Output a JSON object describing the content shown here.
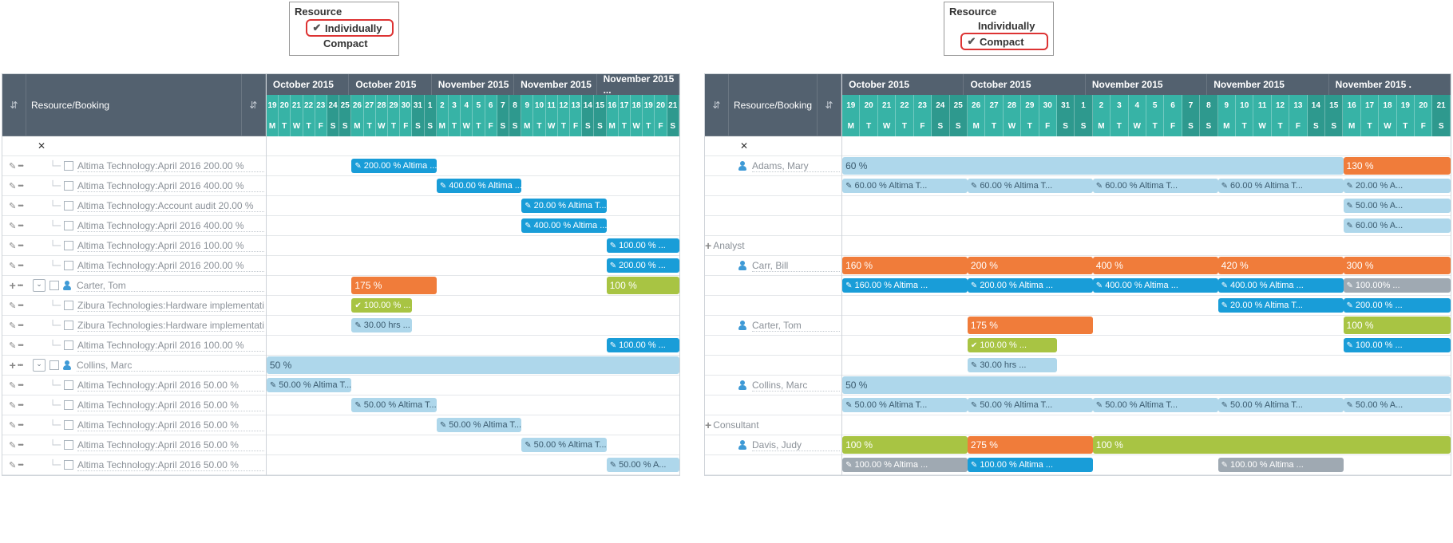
{
  "left": {
    "resource_title": "Resource",
    "options": [
      "Individually",
      "Compact"
    ],
    "selected_index": 0,
    "header_label": "Resource/Booking",
    "months": [
      "October 2015",
      "October 2015",
      "November 2015",
      "November 2015",
      "November 2015 ..."
    ],
    "days_num": [
      "19",
      "20",
      "21",
      "22",
      "23",
      "24",
      "25",
      "26",
      "27",
      "28",
      "29",
      "30",
      "31",
      "1",
      "2",
      "3",
      "4",
      "5",
      "6",
      "7",
      "8",
      "9",
      "10",
      "11",
      "12",
      "13",
      "14",
      "15",
      "16",
      "17",
      "18",
      "19",
      "20",
      "21"
    ],
    "days_dow": [
      "M",
      "T",
      "W",
      "T",
      "F",
      "S",
      "S",
      "M",
      "T",
      "W",
      "T",
      "F",
      "S",
      "S",
      "M",
      "T",
      "W",
      "T",
      "F",
      "S",
      "S",
      "M",
      "T",
      "W",
      "T",
      "F",
      "S",
      "S",
      "M",
      "T",
      "W",
      "T",
      "F",
      "S"
    ],
    "rows": [
      {
        "type": "close"
      },
      {
        "type": "item",
        "label": "Altima Technology:April 2016 200.00 %",
        "bars": [
          {
            "start": 7,
            "span": 7,
            "cls": "c-blue",
            "icon": "pen",
            "text": "200.00 % Altima ..."
          }
        ]
      },
      {
        "type": "item",
        "label": "Altima Technology:April 2016 400.00 %",
        "bars": [
          {
            "start": 14,
            "span": 7,
            "cls": "c-blue",
            "icon": "pen",
            "text": "400.00 % Altima ..."
          }
        ]
      },
      {
        "type": "item",
        "label": "Altima Technology:Account audit 20.00 %",
        "bars": [
          {
            "start": 21,
            "span": 7,
            "cls": "c-blue",
            "icon": "pen",
            "text": "20.00 % Altima T..."
          }
        ]
      },
      {
        "type": "item",
        "label": "Altima Technology:April 2016 400.00 %",
        "bars": [
          {
            "start": 21,
            "span": 7,
            "cls": "c-blue",
            "icon": "pen",
            "text": "400.00 % Altima ..."
          }
        ]
      },
      {
        "type": "item",
        "label": "Altima Technology:April 2016 100.00 %",
        "bars": [
          {
            "start": 28,
            "span": 6,
            "cls": "c-blue",
            "icon": "pen",
            "text": "100.00 % ..."
          }
        ]
      },
      {
        "type": "item",
        "label": "Altima Technology:April 2016 200.00 %",
        "bars": [
          {
            "start": 28,
            "span": 6,
            "cls": "c-blue",
            "icon": "pen",
            "text": "200.00 % ..."
          }
        ]
      },
      {
        "type": "group",
        "label": "Carter, Tom",
        "bars": [
          {
            "start": 7,
            "span": 7,
            "cls": "c-orange tall",
            "text": "175 %"
          },
          {
            "start": 28,
            "span": 6,
            "cls": "c-olive tall",
            "text": "100 %"
          }
        ]
      },
      {
        "type": "item",
        "label": "Zibura Technologies:Hardware implementati",
        "bars": [
          {
            "start": 7,
            "span": 5,
            "cls": "c-olive",
            "icon": "chk",
            "text": "100.00 % ..."
          }
        ]
      },
      {
        "type": "item",
        "label": "Zibura Technologies:Hardware implementati",
        "bars": [
          {
            "start": 7,
            "span": 5,
            "cls": "c-lightblue",
            "icon": "pen",
            "text": "30.00 hrs ..."
          }
        ]
      },
      {
        "type": "item",
        "label": "Altima Technology:April 2016 100.00 %",
        "bars": [
          {
            "start": 28,
            "span": 6,
            "cls": "c-blue",
            "icon": "pen",
            "text": "100.00 % ..."
          }
        ]
      },
      {
        "type": "group",
        "label": "Collins, Marc",
        "bars": [
          {
            "start": 0,
            "span": 34,
            "cls": "c-lightblue tall",
            "text": "50 %"
          }
        ]
      },
      {
        "type": "item",
        "label": "Altima Technology:April 2016 50.00 %",
        "bars": [
          {
            "start": 0,
            "span": 7,
            "cls": "c-lightblue",
            "icon": "pen",
            "text": "50.00 % Altima T..."
          }
        ]
      },
      {
        "type": "item",
        "label": "Altima Technology:April 2016 50.00 %",
        "bars": [
          {
            "start": 7,
            "span": 7,
            "cls": "c-lightblue",
            "icon": "pen",
            "text": "50.00 % Altima T..."
          }
        ]
      },
      {
        "type": "item",
        "label": "Altima Technology:April 2016 50.00 %",
        "bars": [
          {
            "start": 14,
            "span": 7,
            "cls": "c-lightblue",
            "icon": "pen",
            "text": "50.00 % Altima T..."
          }
        ]
      },
      {
        "type": "item",
        "label": "Altima Technology:April 2016 50.00 %",
        "bars": [
          {
            "start": 21,
            "span": 7,
            "cls": "c-lightblue",
            "icon": "pen",
            "text": "50.00 % Altima T..."
          }
        ]
      },
      {
        "type": "item",
        "label": "Altima Technology:April 2016 50.00 %",
        "bars": [
          {
            "start": 28,
            "span": 6,
            "cls": "c-lightblue",
            "icon": "pen",
            "text": "50.00 % A..."
          }
        ]
      }
    ]
  },
  "right": {
    "resource_title": "Resource",
    "options": [
      "Individually",
      "Compact"
    ],
    "selected_index": 1,
    "header_label": "Resource/Booking",
    "months": [
      "October 2015",
      "October 2015",
      "November 2015",
      "November 2015",
      "November 2015 ."
    ],
    "days_num": [
      "19",
      "20",
      "21",
      "22",
      "23",
      "24",
      "25",
      "26",
      "27",
      "28",
      "29",
      "30",
      "31",
      "1",
      "2",
      "3",
      "4",
      "5",
      "6",
      "7",
      "8",
      "9",
      "10",
      "11",
      "12",
      "13",
      "14",
      "15",
      "16",
      "17",
      "18",
      "19",
      "20",
      "21"
    ],
    "days_dow": [
      "M",
      "T",
      "W",
      "T",
      "F",
      "S",
      "S",
      "M",
      "T",
      "W",
      "T",
      "F",
      "S",
      "S",
      "M",
      "T",
      "W",
      "T",
      "F",
      "S",
      "S",
      "M",
      "T",
      "W",
      "T",
      "F",
      "S",
      "S",
      "M",
      "T",
      "W",
      "T",
      "F",
      "S"
    ],
    "rows": [
      {
        "type": "close"
      },
      {
        "type": "person",
        "label": "Adams, Mary",
        "bars": [
          {
            "start": 0,
            "span": 28,
            "cls": "c-lightblue tall",
            "text": "60 %"
          },
          {
            "start": 28,
            "span": 6,
            "cls": "c-orange tall",
            "text": "130 %"
          }
        ]
      },
      {
        "type": "blank",
        "bars": [
          {
            "start": 0,
            "span": 7,
            "cls": "c-lightblue",
            "icon": "pen",
            "text": "60.00 % Altima T..."
          },
          {
            "start": 7,
            "span": 7,
            "cls": "c-lightblue",
            "icon": "pen",
            "text": "60.00 % Altima T..."
          },
          {
            "start": 14,
            "span": 7,
            "cls": "c-lightblue",
            "icon": "pen",
            "text": "60.00 % Altima T..."
          },
          {
            "start": 21,
            "span": 7,
            "cls": "c-lightblue",
            "icon": "pen",
            "text": "60.00 % Altima T..."
          },
          {
            "start": 28,
            "span": 6,
            "cls": "c-lightblue",
            "icon": "pen",
            "text": "20.00 % A..."
          }
        ]
      },
      {
        "type": "blank",
        "bars": [
          {
            "start": 28,
            "span": 6,
            "cls": "c-lightblue",
            "icon": "pen",
            "text": "50.00 % A..."
          }
        ]
      },
      {
        "type": "blank",
        "bars": [
          {
            "start": 28,
            "span": 6,
            "cls": "c-lightblue",
            "icon": "pen",
            "text": "60.00 % A..."
          }
        ]
      },
      {
        "type": "groupplus",
        "label": "Analyst",
        "bars": []
      },
      {
        "type": "person",
        "label": "Carr, Bill",
        "bars": [
          {
            "start": 0,
            "span": 7,
            "cls": "c-orange tall",
            "text": "160 %"
          },
          {
            "start": 7,
            "span": 7,
            "cls": "c-orange tall",
            "text": "200 %"
          },
          {
            "start": 14,
            "span": 7,
            "cls": "c-orange tall",
            "text": "400 %"
          },
          {
            "start": 21,
            "span": 7,
            "cls": "c-orange tall",
            "text": "420 %"
          },
          {
            "start": 28,
            "span": 6,
            "cls": "c-orange tall",
            "text": "300 %"
          }
        ]
      },
      {
        "type": "blank",
        "bars": [
          {
            "start": 0,
            "span": 7,
            "cls": "c-blue",
            "icon": "pen",
            "text": "160.00 % Altima ..."
          },
          {
            "start": 7,
            "span": 7,
            "cls": "c-blue",
            "icon": "pen",
            "text": "200.00 % Altima ..."
          },
          {
            "start": 14,
            "span": 7,
            "cls": "c-blue",
            "icon": "pen",
            "text": "400.00 % Altima ..."
          },
          {
            "start": 21,
            "span": 7,
            "cls": "c-blue",
            "icon": "pen",
            "text": "400.00 % Altima ..."
          },
          {
            "start": 28,
            "span": 6,
            "cls": "c-gray",
            "icon": "pen",
            "text": "100.00% ..."
          }
        ]
      },
      {
        "type": "blank",
        "bars": [
          {
            "start": 21,
            "span": 7,
            "cls": "c-blue",
            "icon": "pen",
            "text": "20.00 % Altima T..."
          },
          {
            "start": 28,
            "span": 6,
            "cls": "c-blue",
            "icon": "pen",
            "text": "200.00 % ..."
          }
        ]
      },
      {
        "type": "person",
        "label": "Carter, Tom",
        "bars": [
          {
            "start": 7,
            "span": 7,
            "cls": "c-orange tall",
            "text": "175 %"
          },
          {
            "start": 28,
            "span": 6,
            "cls": "c-olive tall",
            "text": "100 %"
          }
        ]
      },
      {
        "type": "blank",
        "bars": [
          {
            "start": 7,
            "span": 5,
            "cls": "c-olive",
            "icon": "chk",
            "text": "100.00 % ..."
          },
          {
            "start": 28,
            "span": 6,
            "cls": "c-blue",
            "icon": "pen",
            "text": "100.00 % ..."
          }
        ]
      },
      {
        "type": "blank",
        "bars": [
          {
            "start": 7,
            "span": 5,
            "cls": "c-lightblue",
            "icon": "pen",
            "text": "30.00 hrs ..."
          }
        ]
      },
      {
        "type": "person",
        "label": "Collins, Marc",
        "bars": [
          {
            "start": 0,
            "span": 34,
            "cls": "c-lightblue tall",
            "text": "50 %"
          }
        ]
      },
      {
        "type": "blank",
        "bars": [
          {
            "start": 0,
            "span": 7,
            "cls": "c-lightblue",
            "icon": "pen",
            "text": "50.00 % Altima T..."
          },
          {
            "start": 7,
            "span": 7,
            "cls": "c-lightblue",
            "icon": "pen",
            "text": "50.00 % Altima T..."
          },
          {
            "start": 14,
            "span": 7,
            "cls": "c-lightblue",
            "icon": "pen",
            "text": "50.00 % Altima T..."
          },
          {
            "start": 21,
            "span": 7,
            "cls": "c-lightblue",
            "icon": "pen",
            "text": "50.00 % Altima T..."
          },
          {
            "start": 28,
            "span": 6,
            "cls": "c-lightblue",
            "icon": "pen",
            "text": "50.00 % A..."
          }
        ]
      },
      {
        "type": "groupplus",
        "label": "Consultant",
        "bars": []
      },
      {
        "type": "person",
        "label": "Davis, Judy",
        "bars": [
          {
            "start": 0,
            "span": 7,
            "cls": "c-olive tall",
            "text": "100 %"
          },
          {
            "start": 7,
            "span": 7,
            "cls": "c-orange tall",
            "text": "275 %"
          },
          {
            "start": 14,
            "span": 20,
            "cls": "c-olive tall",
            "text": "100 %"
          }
        ]
      },
      {
        "type": "blank",
        "bars": [
          {
            "start": 0,
            "span": 7,
            "cls": "c-gray",
            "icon": "pen",
            "text": "100.00 % Altima ..."
          },
          {
            "start": 7,
            "span": 7,
            "cls": "c-blue",
            "icon": "pen",
            "text": "100.00 % Altima ..."
          },
          {
            "start": 21,
            "span": 7,
            "cls": "c-gray",
            "icon": "pen",
            "text": "100.00 % Altima ..."
          }
        ]
      }
    ]
  }
}
